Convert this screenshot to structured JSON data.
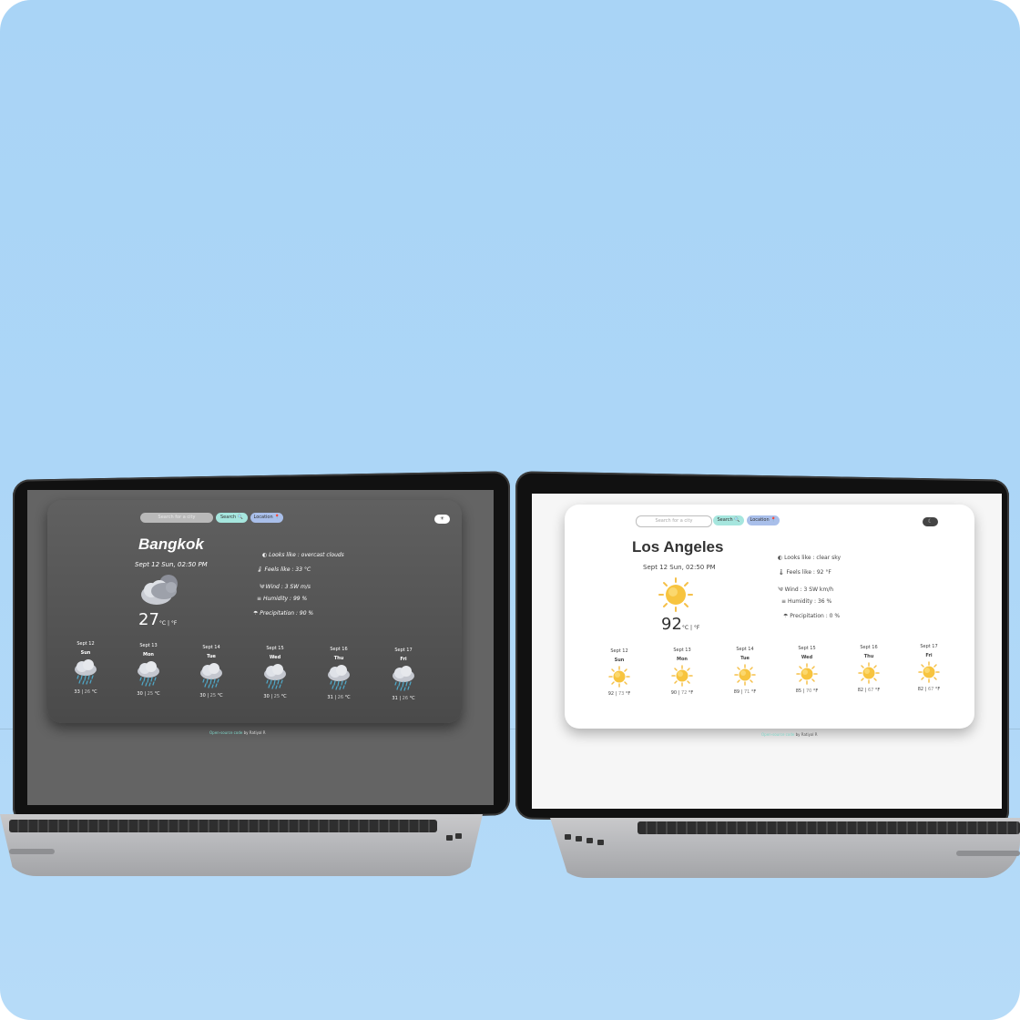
{
  "left": {
    "search_placeholder": "Search for a city",
    "search_button": "Search 🔍",
    "location_button": "Location 📍",
    "toggle": "☀",
    "city": "Bangkok",
    "datetime": "Sept 12 Sun, 02:50 PM",
    "temperature": "27",
    "units": "°C | °F",
    "details": {
      "looks_like": "Looks like : overcast clouds",
      "feels_like": "Feels like : 33 °C",
      "wind": "Wind : 3 SW m/s",
      "humidity": "Humidity : 99 %",
      "precipitation": "Precipitation : 90 %"
    },
    "forecast": [
      {
        "date": "Sept 12",
        "day": "Sun",
        "hi": "33",
        "lo": "26",
        "unit": "°C"
      },
      {
        "date": "Sept 13",
        "day": "Mon",
        "hi": "30",
        "lo": "25",
        "unit": "°C"
      },
      {
        "date": "Sept 14",
        "day": "Tue",
        "hi": "30",
        "lo": "25",
        "unit": "°C"
      },
      {
        "date": "Sept 15",
        "day": "Wed",
        "hi": "30",
        "lo": "25",
        "unit": "°C"
      },
      {
        "date": "Sept 16",
        "day": "Thu",
        "hi": "31",
        "lo": "26",
        "unit": "°C"
      },
      {
        "date": "Sept 17",
        "day": "Fri",
        "hi": "31",
        "lo": "26",
        "unit": "°C"
      }
    ],
    "footer_link": "Open-source code",
    "footer_by": " by Ratiyal R"
  },
  "right": {
    "search_placeholder": "Search for a city",
    "search_button": "Search 🔍",
    "location_button": "Location 📍",
    "toggle": "☾",
    "city": "Los Angeles",
    "datetime": "Sept 12 Sun, 02:50 PM",
    "temperature": "92",
    "units": "°C | °F",
    "details": {
      "looks_like": "Looks like : clear sky",
      "feels_like": "Feels like : 92 °F",
      "wind": "Wind : 3 SW km/h",
      "humidity": "Humidity : 36 %",
      "precipitation": "Precipitation : 0 %"
    },
    "forecast": [
      {
        "date": "Sept 12",
        "day": "Sun",
        "hi": "92",
        "lo": "73",
        "unit": "°F"
      },
      {
        "date": "Sept 13",
        "day": "Mon",
        "hi": "90",
        "lo": "72",
        "unit": "°F"
      },
      {
        "date": "Sept 14",
        "day": "Tue",
        "hi": "89",
        "lo": "71",
        "unit": "°F"
      },
      {
        "date": "Sept 15",
        "day": "Wed",
        "hi": "85",
        "lo": "70",
        "unit": "°F"
      },
      {
        "date": "Sept 16",
        "day": "Thu",
        "hi": "82",
        "lo": "67",
        "unit": "°F"
      },
      {
        "date": "Sept 17",
        "day": "Fri",
        "hi": "82",
        "lo": "67",
        "unit": "°F"
      }
    ],
    "footer_link": "Open-source code",
    "footer_by": " by Ratiyal R"
  },
  "icons": {
    "rain": "rain-cloud-icon",
    "overcast": "overcast-cloud-icon",
    "sun": "sun-icon"
  },
  "colors": {
    "background": "#aad5f7",
    "accent_search": "#a6e6de",
    "accent_location": "#a9bfea",
    "dark_card": "#555555"
  }
}
